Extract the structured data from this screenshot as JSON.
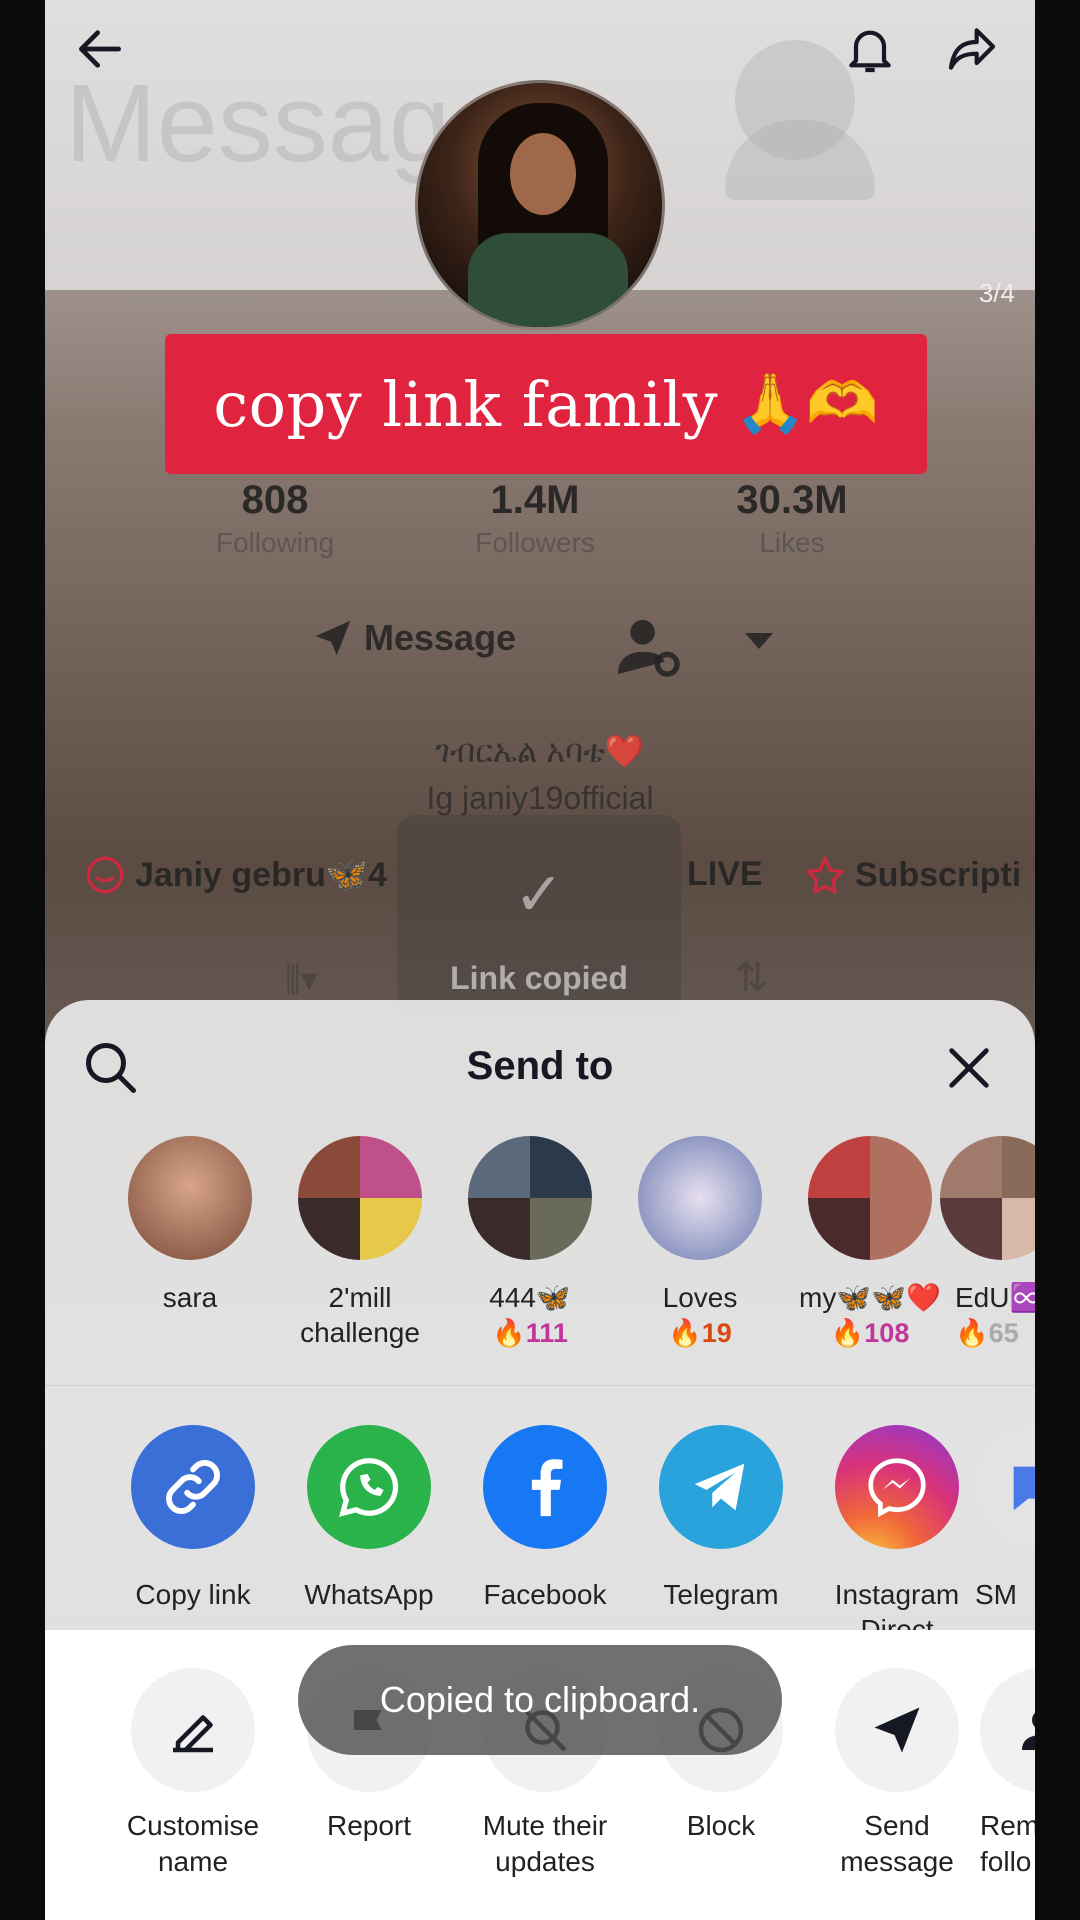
{
  "banner": {
    "text": "copy link family",
    "emoji": "🙏🫶"
  },
  "profile": {
    "ghost_title": "Message",
    "page_counter": "3/4",
    "stats": [
      {
        "value": "808",
        "label": "Following"
      },
      {
        "value": "1.4M",
        "label": "Followers"
      },
      {
        "value": "30.3M",
        "label": "Likes"
      }
    ],
    "message_label": "Message",
    "bio_line1": "ገብርኤል አባቴ❤️",
    "bio_line2": "Ig janiy19official",
    "chip_playlist": "Janiy gebru🦋4",
    "chip_live": "LIVE",
    "chip_subscription": "Subscripti",
    "link_copied": "Link copied"
  },
  "sheet": {
    "title": "Send to",
    "contacts": [
      {
        "name": "sara",
        "streak": "",
        "color": "#a07060"
      },
      {
        "name": "2'mill challenge",
        "streak": "",
        "color": "#b04a7a"
      },
      {
        "name": "444🦋",
        "streak": "111",
        "color": "#556070"
      },
      {
        "name": "Loves",
        "streak": "19",
        "color": "#6a7ab0"
      },
      {
        "name": "my🦋🦋❤️",
        "streak": "108",
        "color": "#b07060"
      },
      {
        "name": "EdU♾️",
        "streak": "65",
        "color": "#8a6a5a"
      }
    ],
    "apps": [
      {
        "label": "Copy link",
        "color": "#3b6fd8"
      },
      {
        "label": "WhatsApp",
        "color": "#29b34a"
      },
      {
        "label": "Facebook",
        "color": "#1877f2"
      },
      {
        "label": "Telegram",
        "color": "#2aa3dd"
      },
      {
        "label": "Instagram Direct",
        "color": "#d8327a"
      },
      {
        "label": "SM",
        "color": "#e3e3e5"
      }
    ],
    "actions": [
      {
        "label": "Customise name"
      },
      {
        "label": "Report"
      },
      {
        "label": "Mute their updates"
      },
      {
        "label": "Block"
      },
      {
        "label": "Send message"
      },
      {
        "label": "Remov follo"
      }
    ]
  },
  "toast": {
    "text": "Copied to clipboard."
  }
}
